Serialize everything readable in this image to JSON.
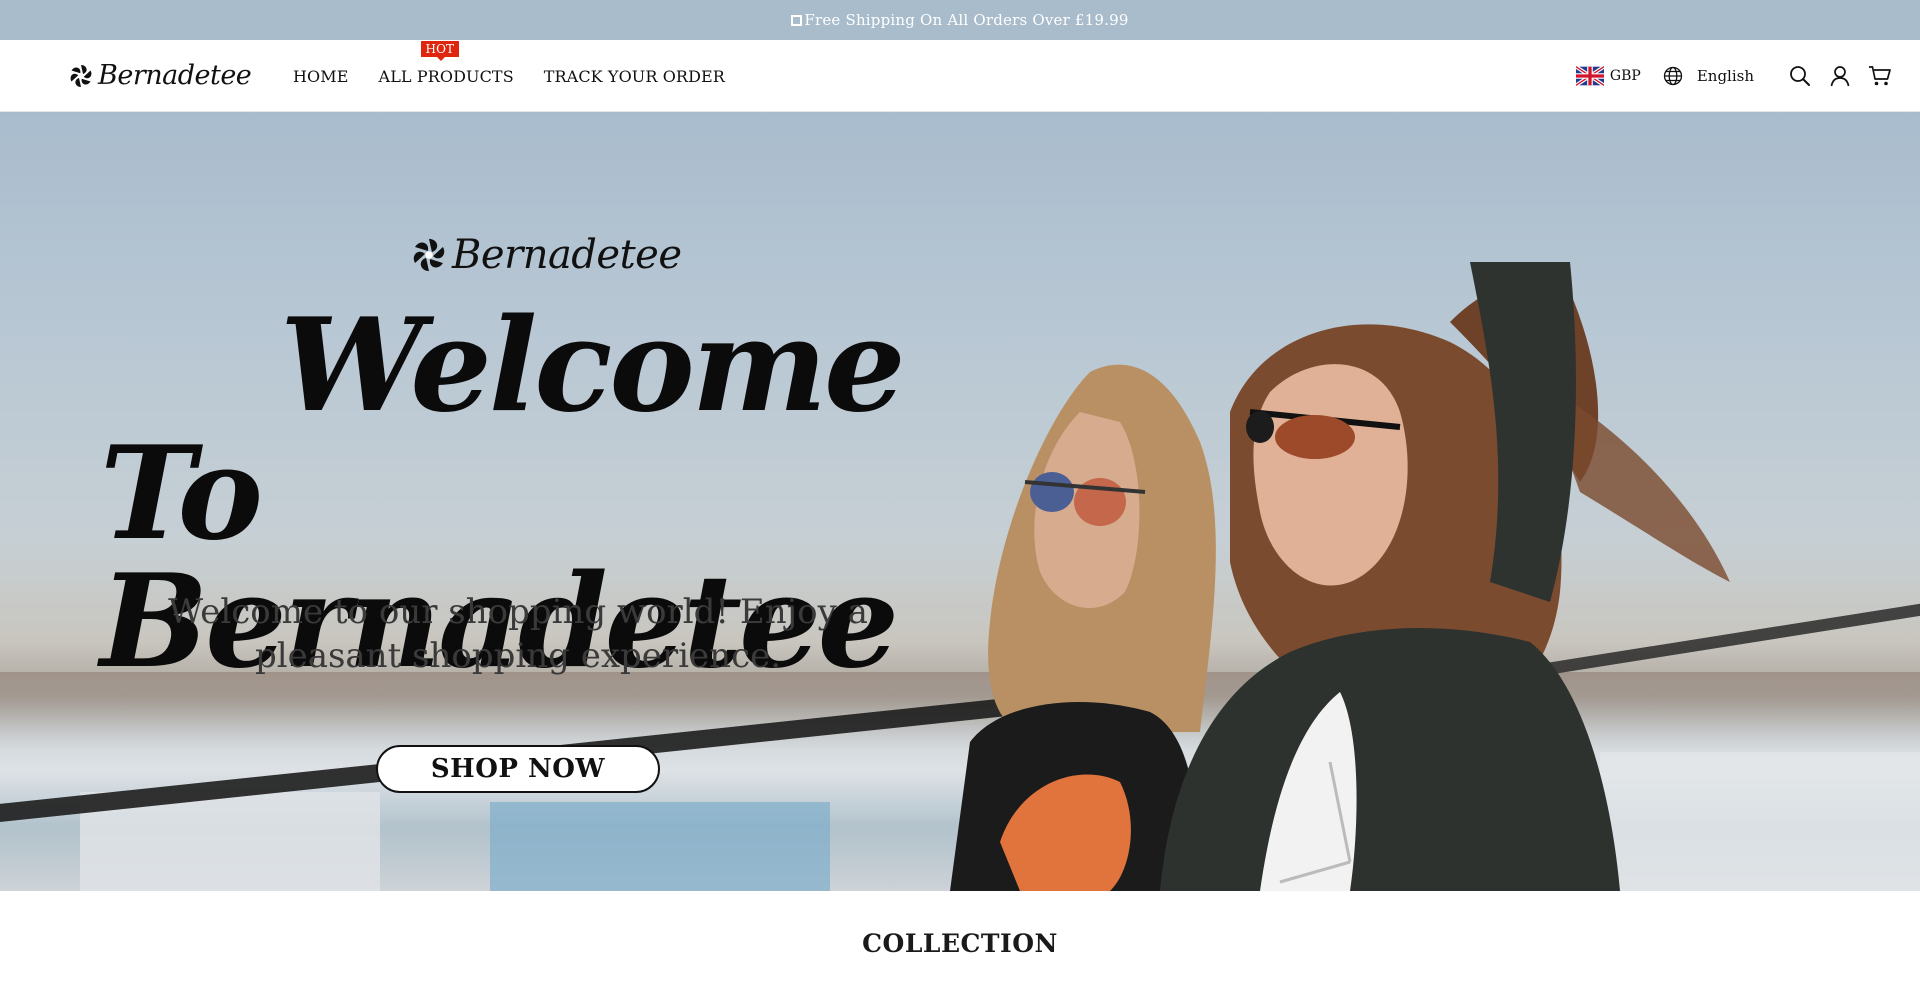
{
  "announcement": {
    "text": "Free Shipping On All Orders Over £19.99"
  },
  "header": {
    "brand": "Bernadetee",
    "nav": [
      {
        "label": "HOME"
      },
      {
        "label": "ALL PRODUCTS",
        "badge": "HOT"
      },
      {
        "label": "TRACK YOUR ORDER"
      }
    ],
    "currency": "GBP",
    "language": "English",
    "icons": [
      "uk-flag-icon",
      "globe-icon",
      "search-icon",
      "account-icon",
      "cart-icon"
    ]
  },
  "hero": {
    "brand": "Bernadetee",
    "title_line1": "Welcome",
    "title_line2": "To Bernadetee",
    "subtitle": "Welcome to our shopping world! Enjoy a pleasant shopping experience.",
    "cta": "SHOP NOW"
  },
  "collection": {
    "title": "COLLECTION"
  },
  "colors": {
    "announce_bg": "#a9bccc",
    "badge": "#e0250f"
  }
}
